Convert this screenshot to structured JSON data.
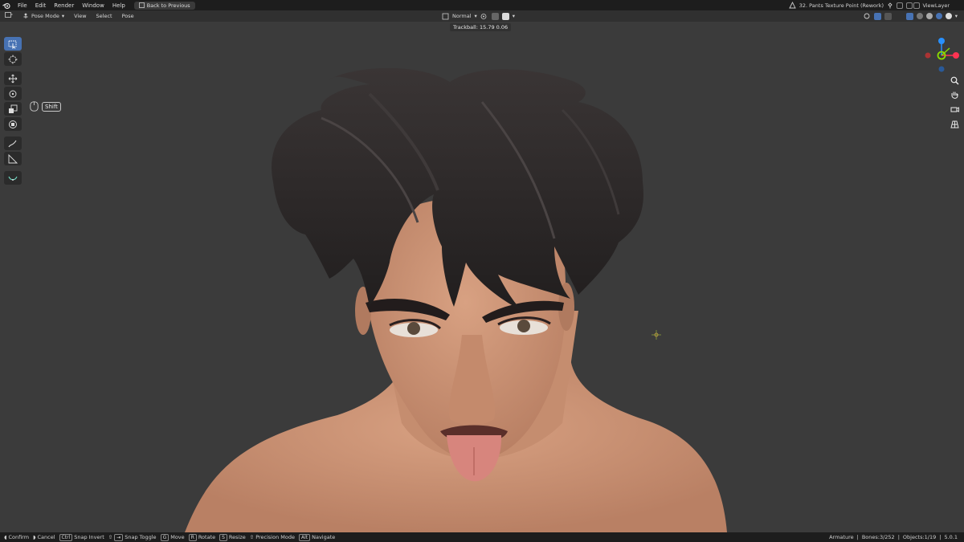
{
  "menubar": {
    "items": [
      "File",
      "Edit",
      "Render",
      "Window",
      "Help"
    ],
    "back_button": "Back to Previous",
    "scene_name": "32. Pants Texture Point (Rework)",
    "view_layer": "ViewLayer"
  },
  "viewport_header": {
    "mode": "Pose Mode",
    "menus": [
      "View",
      "Select",
      "Pose"
    ],
    "orientation": "Normal"
  },
  "overlay": {
    "trackball_text": "Trackball: 15.79 0.06",
    "shift_key": "Shift"
  },
  "statusbar": {
    "items": [
      "Confirm",
      "Cancel",
      "Snap Invert",
      "Snap Toggle",
      "Move",
      "Rotate",
      "Resize",
      "Precision Mode",
      "Navigate"
    ],
    "keys": [
      "Ctrl",
      "G",
      "R",
      "S",
      "Alt"
    ],
    "armature": "Armature",
    "bones": "Bones:3/252",
    "objects": "Objects:1/19",
    "version": "5.0.1"
  },
  "gizmo": {
    "axes": [
      "Z",
      "Y",
      "X"
    ],
    "colors": {
      "x": "#ff3352",
      "y": "#8bdc00",
      "z": "#2890ff"
    }
  },
  "colors": {
    "accent": "#4772b3",
    "viewport_bg": "#3b3b3b",
    "skin": "#c99677",
    "hair": "#2a2626"
  }
}
